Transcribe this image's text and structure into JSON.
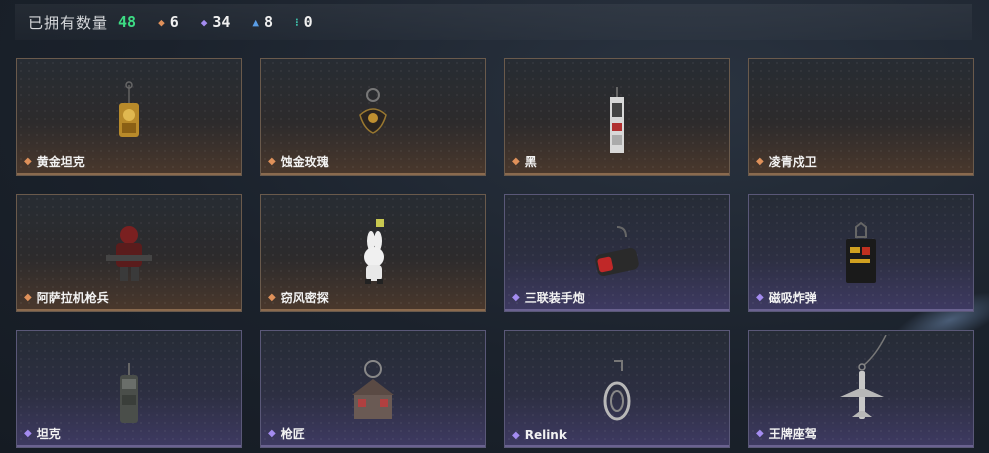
{
  "summary": {
    "owned_label": "已拥有数量",
    "owned_total": "48",
    "counts": [
      {
        "icon": "orange-gem-icon",
        "color": "#e0915a",
        "value": "6"
      },
      {
        "icon": "purple-gem-icon",
        "color": "#a48cf0",
        "value": "34"
      },
      {
        "icon": "blue-gem-icon",
        "color": "#5a9ee8",
        "value": "8"
      },
      {
        "icon": "teal-gem-icon",
        "color": "#3fc7b0",
        "value": "0"
      }
    ]
  },
  "colors": {
    "total_green": "#3ddc84",
    "orange_rarity": "#e0915a",
    "purple_rarity": "#a48cf0"
  },
  "items": [
    {
      "name": "黄金坦克",
      "rarity": "orange",
      "icon": "golden-tank-charm-icon"
    },
    {
      "name": "蚀金玫瑰",
      "rarity": "orange",
      "icon": "gold-rose-charm-icon"
    },
    {
      "name": "黑",
      "rarity": "orange",
      "icon": "black-tag-charm-icon"
    },
    {
      "name": "凌青戍卫",
      "rarity": "orange",
      "icon": ""
    },
    {
      "name": "阿萨拉机枪兵",
      "rarity": "orange",
      "icon": "gunner-figure-charm-icon"
    },
    {
      "name": "窃风密探",
      "rarity": "orange",
      "icon": "rabbit-spy-charm-icon"
    },
    {
      "name": "三联装手炮",
      "rarity": "purple",
      "icon": "triple-hand-cannon-charm-icon"
    },
    {
      "name": "磁吸炸弹",
      "rarity": "purple",
      "icon": "magnetic-bomb-charm-icon"
    },
    {
      "name": "坦克",
      "rarity": "purple",
      "icon": "tank-charm-icon"
    },
    {
      "name": "枪匠",
      "rarity": "purple",
      "icon": "gunsmith-house-charm-icon"
    },
    {
      "name": "Relink",
      "rarity": "purple",
      "icon": "relink-cage-charm-icon"
    },
    {
      "name": "王牌座驾",
      "rarity": "purple",
      "icon": "jet-plane-charm-icon"
    }
  ]
}
